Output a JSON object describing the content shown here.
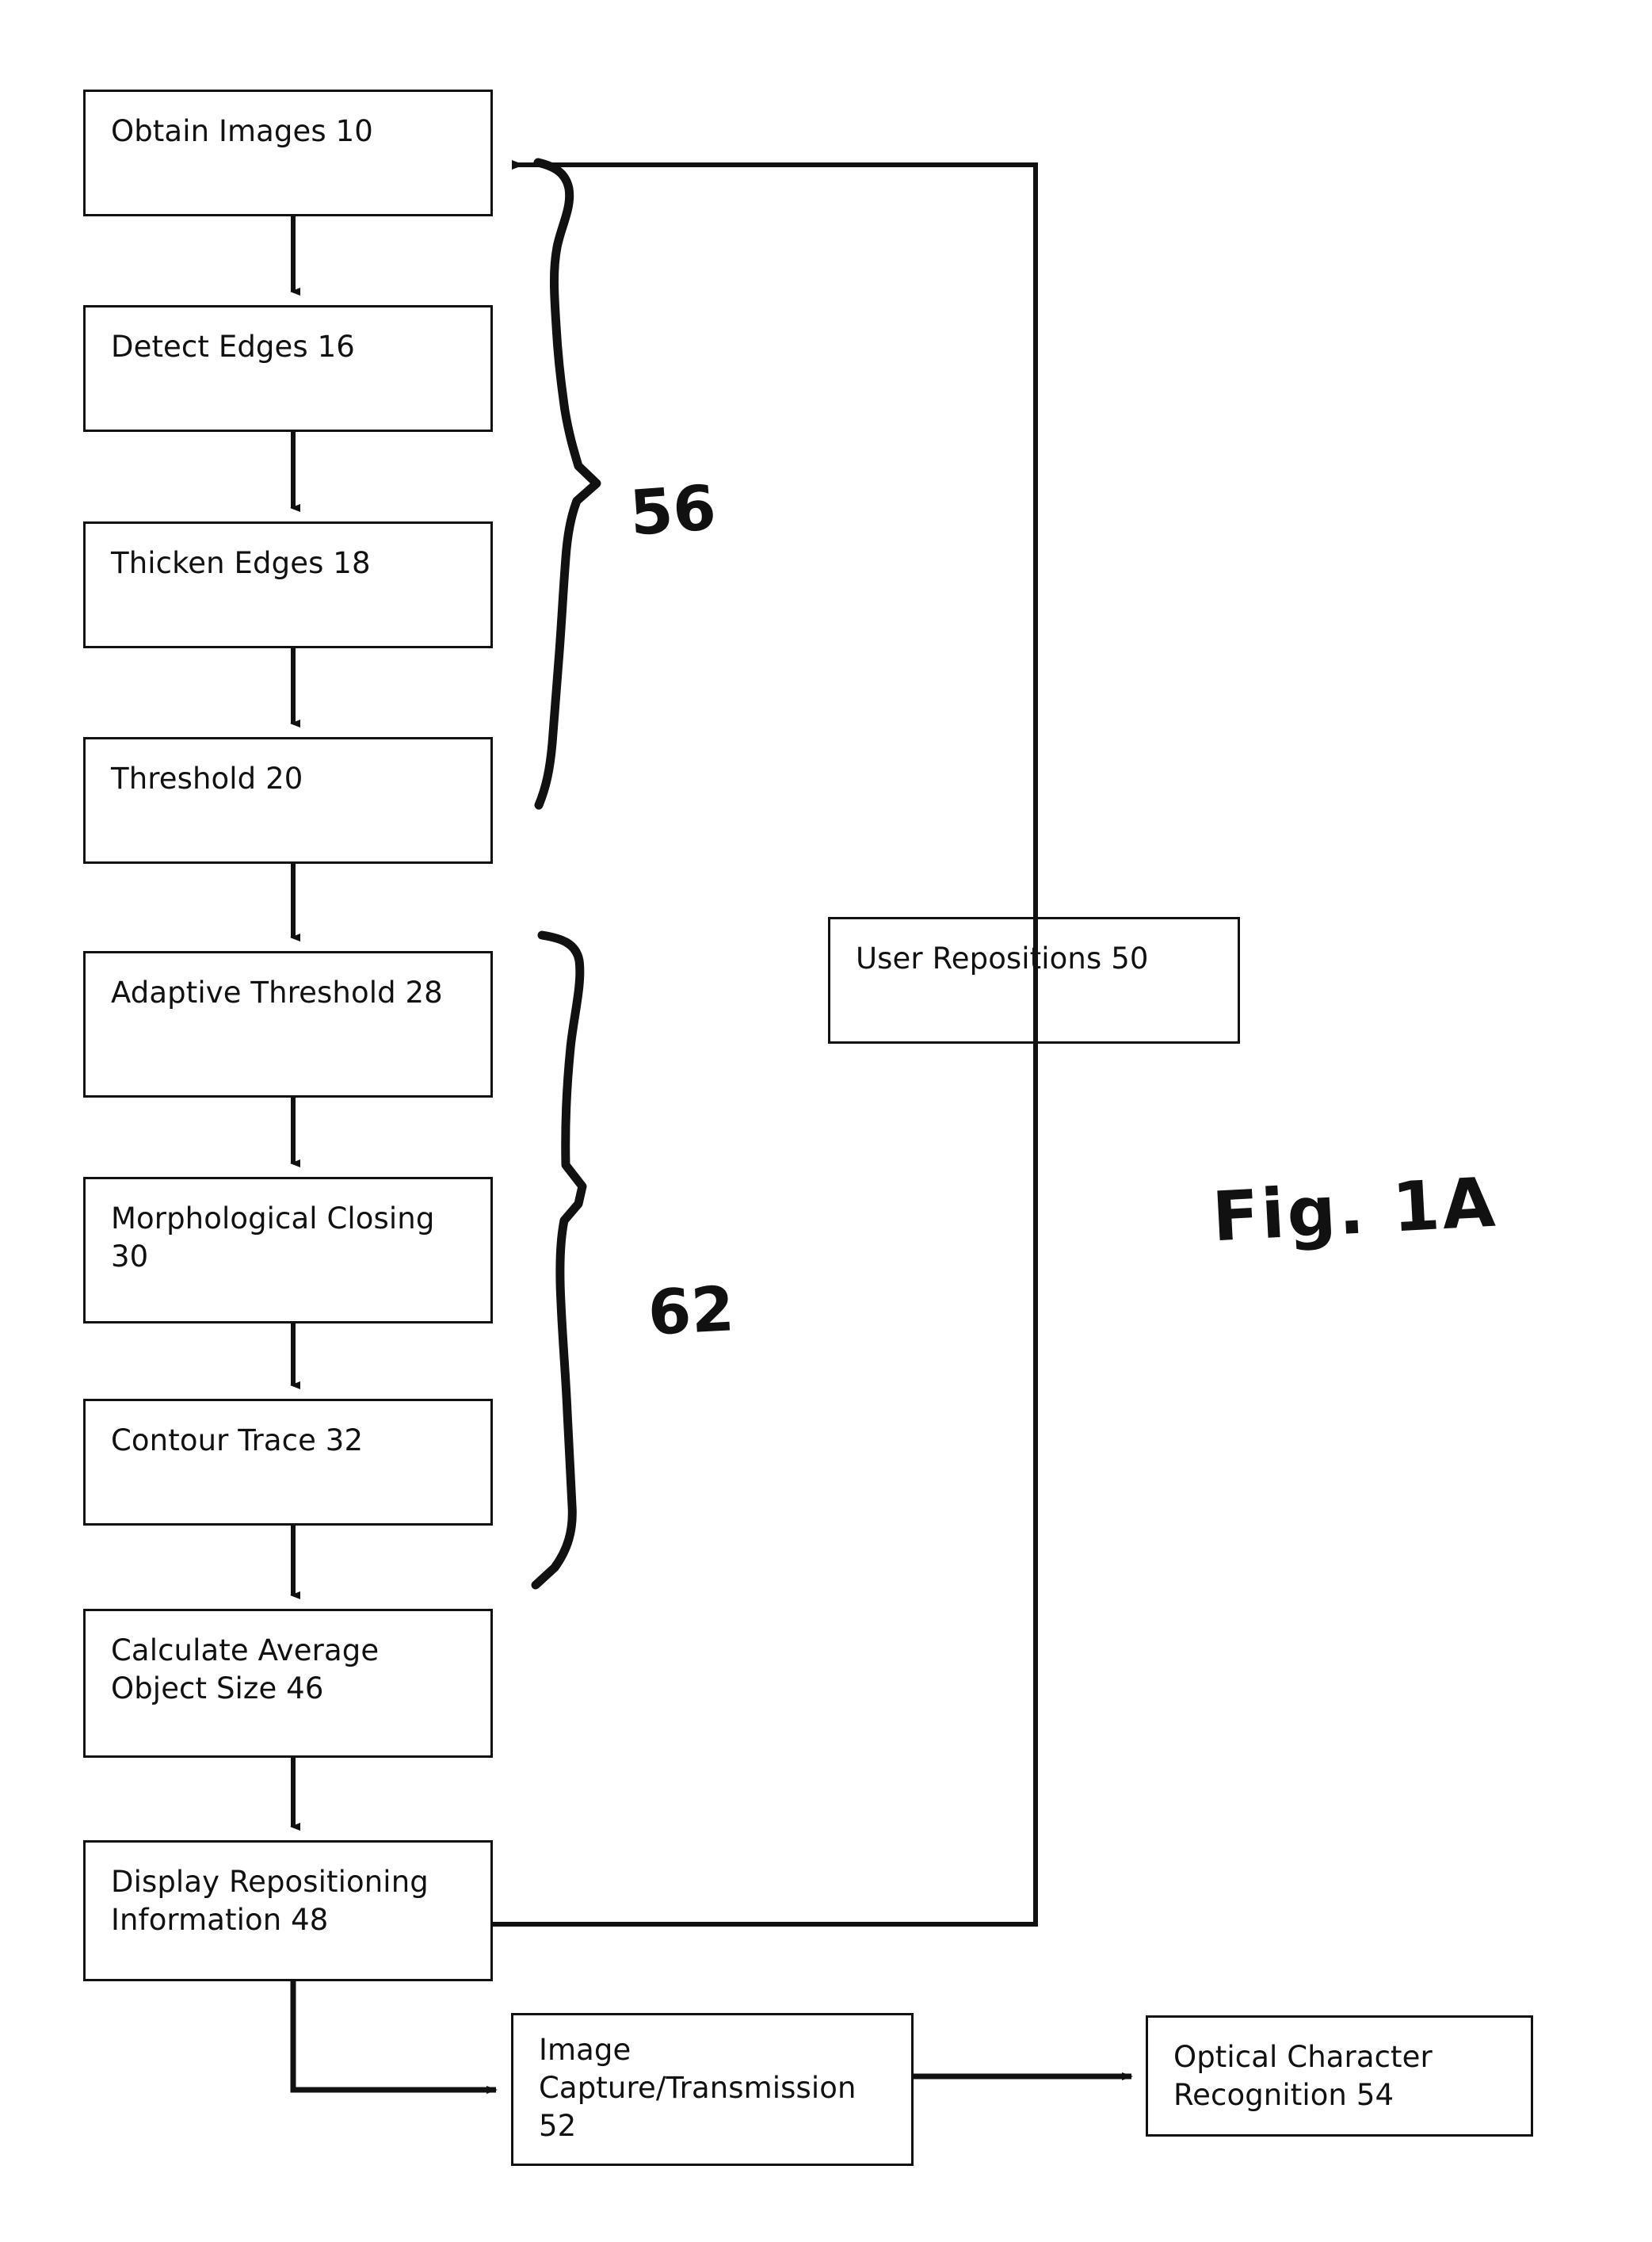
{
  "figure": {
    "label": "Fig. 1A",
    "type": "patent-flowchart"
  },
  "boxes": {
    "obtain_images": "Obtain Images 10",
    "detect_edges": "Detect Edges 16",
    "thicken_edges": "Thicken Edges 18",
    "threshold": "Threshold 20",
    "adaptive_threshold": "Adaptive Threshold 28",
    "morphological_closing": "Morphological Closing\n30",
    "contour_trace": "Contour Trace 32",
    "calculate_average_object_size": "Calculate Average\nObject Size 46",
    "display_repositioning_information": "Display Repositioning\nInformation 48",
    "user_repositions": "User Repositions 50",
    "image_capture_transmission": "Image\nCapture/Transmission\n52",
    "optical_character_recognition": "Optical Character\nRecognition 54"
  },
  "brackets": [
    {
      "label": "56",
      "spans": [
        "Obtain Images 10",
        "Detect Edges 16",
        "Thicken Edges 18",
        "Threshold 20"
      ]
    },
    {
      "label": "62",
      "spans": [
        "Adaptive Threshold 28",
        "Morphological Closing 30",
        "Contour Trace 32",
        "Calculate Average Object Size 46"
      ]
    }
  ],
  "colors": {
    "ink": "#111111",
    "paper": "#ffffff"
  }
}
